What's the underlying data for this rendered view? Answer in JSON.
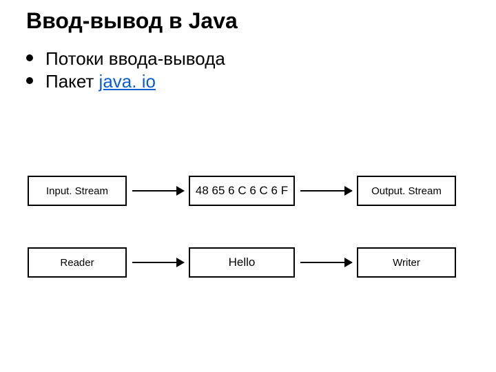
{
  "title": "Ввод-вывод в Java",
  "bullets": {
    "b1": "Потоки ввода-вывода",
    "b2_prefix": "Пакет ",
    "b2_link": "java. io"
  },
  "row1": {
    "left": "Input. Stream",
    "mid": "48 65 6 C 6 C 6 F",
    "right": "Output. Stream"
  },
  "row2": {
    "left": "Reader",
    "mid": "Hello",
    "right": "Writer"
  }
}
